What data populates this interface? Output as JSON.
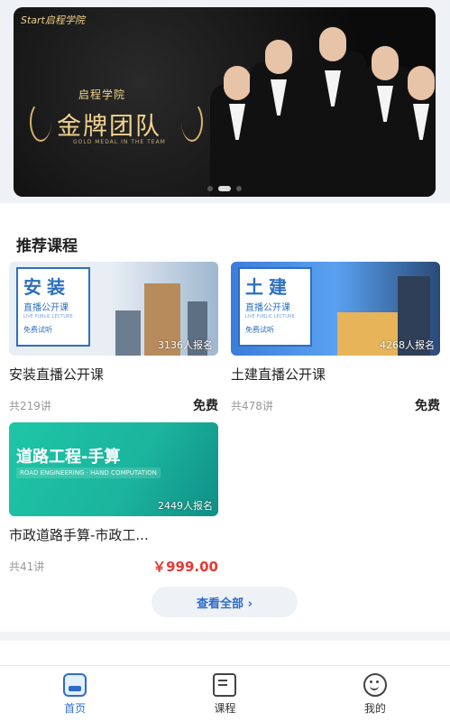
{
  "banner": {
    "logo": "Start启程学院",
    "school": "启程学院",
    "title": "金牌团队",
    "subtitle": "GOLD MEDAL IN THE TEAM"
  },
  "section": {
    "title": "推荐课程"
  },
  "courses": [
    {
      "name": "安装直播公开课",
      "lessons": "共219讲",
      "price": "免费",
      "enrolled": "3136人报名",
      "thumb": {
        "big": "安装",
        "small": "直播公开课",
        "tiny": "LIVE PUBLIC LECTURE",
        "trial": "免费试听"
      }
    },
    {
      "name": "土建直播公开课",
      "lessons": "共478讲",
      "price": "免费",
      "enrolled": "4268人报名",
      "thumb": {
        "big": "土建",
        "small": "直播公开课",
        "tiny": "LIVE PUBLIC LECTURE",
        "trial": "免费试听"
      }
    },
    {
      "name": "市政道路手算-市政工...",
      "lessons": "共41讲",
      "price": "￥999.00",
      "enrolled": "2449人报名",
      "thumb": {
        "big": "道路工程-手算",
        "small": "ROAD ENGINEERING · HAND COMPUTATION"
      }
    }
  ],
  "view_all": "查看全部 ›",
  "tabbar": {
    "items": [
      {
        "label": "首页",
        "icon": "home-icon",
        "active": true
      },
      {
        "label": "课程",
        "icon": "course-icon",
        "active": false
      },
      {
        "label": "我的",
        "icon": "profile-icon",
        "active": false
      }
    ]
  },
  "colors": {
    "accent": "#2e6cc8",
    "price_red": "#e53935"
  }
}
